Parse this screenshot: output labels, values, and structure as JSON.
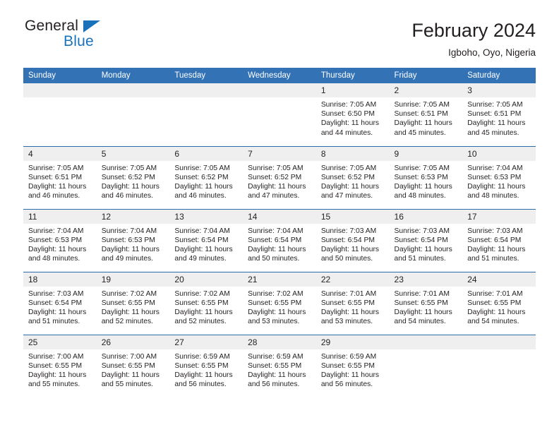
{
  "brand": {
    "name_line1": "General",
    "name_line2": "Blue",
    "triangle_color": "#1a72ba"
  },
  "header": {
    "title": "February 2024",
    "subtitle": "Igboho, Oyo, Nigeria"
  },
  "colors": {
    "header_blue": "#3372b5",
    "row_divider_blue": "#2b6cad",
    "daynum_band": "#efefef",
    "text": "#231f20"
  },
  "weekdays": [
    "Sunday",
    "Monday",
    "Tuesday",
    "Wednesday",
    "Thursday",
    "Friday",
    "Saturday"
  ],
  "labels": {
    "sunrise_prefix": "Sunrise:",
    "sunset_prefix": "Sunset:",
    "daylight_prefix": "Daylight:"
  },
  "weeks": [
    [
      {
        "day": "",
        "empty": true
      },
      {
        "day": "",
        "empty": true
      },
      {
        "day": "",
        "empty": true
      },
      {
        "day": "",
        "empty": true
      },
      {
        "day": "1",
        "sunrise": "Sunrise: 7:05 AM",
        "sunset": "Sunset: 6:50 PM",
        "daylight": "Daylight: 11 hours and 44 minutes."
      },
      {
        "day": "2",
        "sunrise": "Sunrise: 7:05 AM",
        "sunset": "Sunset: 6:51 PM",
        "daylight": "Daylight: 11 hours and 45 minutes."
      },
      {
        "day": "3",
        "sunrise": "Sunrise: 7:05 AM",
        "sunset": "Sunset: 6:51 PM",
        "daylight": "Daylight: 11 hours and 45 minutes."
      }
    ],
    [
      {
        "day": "4",
        "sunrise": "Sunrise: 7:05 AM",
        "sunset": "Sunset: 6:51 PM",
        "daylight": "Daylight: 11 hours and 46 minutes."
      },
      {
        "day": "5",
        "sunrise": "Sunrise: 7:05 AM",
        "sunset": "Sunset: 6:52 PM",
        "daylight": "Daylight: 11 hours and 46 minutes."
      },
      {
        "day": "6",
        "sunrise": "Sunrise: 7:05 AM",
        "sunset": "Sunset: 6:52 PM",
        "daylight": "Daylight: 11 hours and 46 minutes."
      },
      {
        "day": "7",
        "sunrise": "Sunrise: 7:05 AM",
        "sunset": "Sunset: 6:52 PM",
        "daylight": "Daylight: 11 hours and 47 minutes."
      },
      {
        "day": "8",
        "sunrise": "Sunrise: 7:05 AM",
        "sunset": "Sunset: 6:52 PM",
        "daylight": "Daylight: 11 hours and 47 minutes."
      },
      {
        "day": "9",
        "sunrise": "Sunrise: 7:05 AM",
        "sunset": "Sunset: 6:53 PM",
        "daylight": "Daylight: 11 hours and 48 minutes."
      },
      {
        "day": "10",
        "sunrise": "Sunrise: 7:04 AM",
        "sunset": "Sunset: 6:53 PM",
        "daylight": "Daylight: 11 hours and 48 minutes."
      }
    ],
    [
      {
        "day": "11",
        "sunrise": "Sunrise: 7:04 AM",
        "sunset": "Sunset: 6:53 PM",
        "daylight": "Daylight: 11 hours and 48 minutes."
      },
      {
        "day": "12",
        "sunrise": "Sunrise: 7:04 AM",
        "sunset": "Sunset: 6:53 PM",
        "daylight": "Daylight: 11 hours and 49 minutes."
      },
      {
        "day": "13",
        "sunrise": "Sunrise: 7:04 AM",
        "sunset": "Sunset: 6:54 PM",
        "daylight": "Daylight: 11 hours and 49 minutes."
      },
      {
        "day": "14",
        "sunrise": "Sunrise: 7:04 AM",
        "sunset": "Sunset: 6:54 PM",
        "daylight": "Daylight: 11 hours and 50 minutes."
      },
      {
        "day": "15",
        "sunrise": "Sunrise: 7:03 AM",
        "sunset": "Sunset: 6:54 PM",
        "daylight": "Daylight: 11 hours and 50 minutes."
      },
      {
        "day": "16",
        "sunrise": "Sunrise: 7:03 AM",
        "sunset": "Sunset: 6:54 PM",
        "daylight": "Daylight: 11 hours and 51 minutes."
      },
      {
        "day": "17",
        "sunrise": "Sunrise: 7:03 AM",
        "sunset": "Sunset: 6:54 PM",
        "daylight": "Daylight: 11 hours and 51 minutes."
      }
    ],
    [
      {
        "day": "18",
        "sunrise": "Sunrise: 7:03 AM",
        "sunset": "Sunset: 6:54 PM",
        "daylight": "Daylight: 11 hours and 51 minutes."
      },
      {
        "day": "19",
        "sunrise": "Sunrise: 7:02 AM",
        "sunset": "Sunset: 6:55 PM",
        "daylight": "Daylight: 11 hours and 52 minutes."
      },
      {
        "day": "20",
        "sunrise": "Sunrise: 7:02 AM",
        "sunset": "Sunset: 6:55 PM",
        "daylight": "Daylight: 11 hours and 52 minutes."
      },
      {
        "day": "21",
        "sunrise": "Sunrise: 7:02 AM",
        "sunset": "Sunset: 6:55 PM",
        "daylight": "Daylight: 11 hours and 53 minutes."
      },
      {
        "day": "22",
        "sunrise": "Sunrise: 7:01 AM",
        "sunset": "Sunset: 6:55 PM",
        "daylight": "Daylight: 11 hours and 53 minutes."
      },
      {
        "day": "23",
        "sunrise": "Sunrise: 7:01 AM",
        "sunset": "Sunset: 6:55 PM",
        "daylight": "Daylight: 11 hours and 54 minutes."
      },
      {
        "day": "24",
        "sunrise": "Sunrise: 7:01 AM",
        "sunset": "Sunset: 6:55 PM",
        "daylight": "Daylight: 11 hours and 54 minutes."
      }
    ],
    [
      {
        "day": "25",
        "sunrise": "Sunrise: 7:00 AM",
        "sunset": "Sunset: 6:55 PM",
        "daylight": "Daylight: 11 hours and 55 minutes."
      },
      {
        "day": "26",
        "sunrise": "Sunrise: 7:00 AM",
        "sunset": "Sunset: 6:55 PM",
        "daylight": "Daylight: 11 hours and 55 minutes."
      },
      {
        "day": "27",
        "sunrise": "Sunrise: 6:59 AM",
        "sunset": "Sunset: 6:55 PM",
        "daylight": "Daylight: 11 hours and 56 minutes."
      },
      {
        "day": "28",
        "sunrise": "Sunrise: 6:59 AM",
        "sunset": "Sunset: 6:55 PM",
        "daylight": "Daylight: 11 hours and 56 minutes."
      },
      {
        "day": "29",
        "sunrise": "Sunrise: 6:59 AM",
        "sunset": "Sunset: 6:55 PM",
        "daylight": "Daylight: 11 hours and 56 minutes."
      },
      {
        "day": "",
        "empty": true
      },
      {
        "day": "",
        "empty": true
      }
    ]
  ]
}
